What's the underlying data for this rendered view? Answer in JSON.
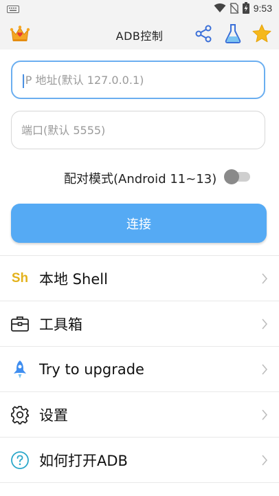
{
  "status_bar": {
    "time": "9:53"
  },
  "app_bar": {
    "title": "ADB控制"
  },
  "inputs": {
    "ip_placeholder": "IP 地址(默认 127.0.0.1)",
    "port_placeholder": "端口(默认 5555)"
  },
  "pairing": {
    "label": "配对模式(Android 11~13)",
    "enabled": false
  },
  "connect_label": "连接",
  "menu": [
    {
      "label": "本地 Shell",
      "icon": "sh-icon",
      "icon_text": "Sh"
    },
    {
      "label": "工具箱",
      "icon": "toolbox-icon"
    },
    {
      "label": "Try to upgrade",
      "icon": "rocket-icon"
    },
    {
      "label": "设置",
      "icon": "gear-icon"
    },
    {
      "label": "如何打开ADB",
      "icon": "help-icon"
    }
  ],
  "colors": {
    "accent": "#55aaf4",
    "crown": "#f5a623",
    "star": "#f5b81c",
    "sh": "#e3b21c"
  }
}
